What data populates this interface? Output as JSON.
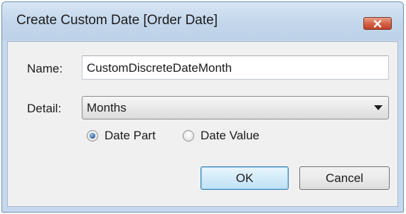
{
  "window": {
    "title": "Create Custom Date [Order Date]",
    "close_icon": "close-icon"
  },
  "form": {
    "name_label": "Name:",
    "name_value": "CustomDiscreteDateMonth",
    "detail_label": "Detail:",
    "detail_value": "Months",
    "dropdown_icon": "chevron-down-icon",
    "radio_options": [
      {
        "label": "Date Part",
        "selected": true
      },
      {
        "label": "Date Value",
        "selected": false
      }
    ]
  },
  "buttons": {
    "ok_label": "OK",
    "cancel_label": "Cancel"
  },
  "colors": {
    "title_bar": "#c3d6eb",
    "close_button": "#d66348",
    "dialog_body": "#f0f0f0",
    "default_button_border": "#3c7fb1"
  }
}
